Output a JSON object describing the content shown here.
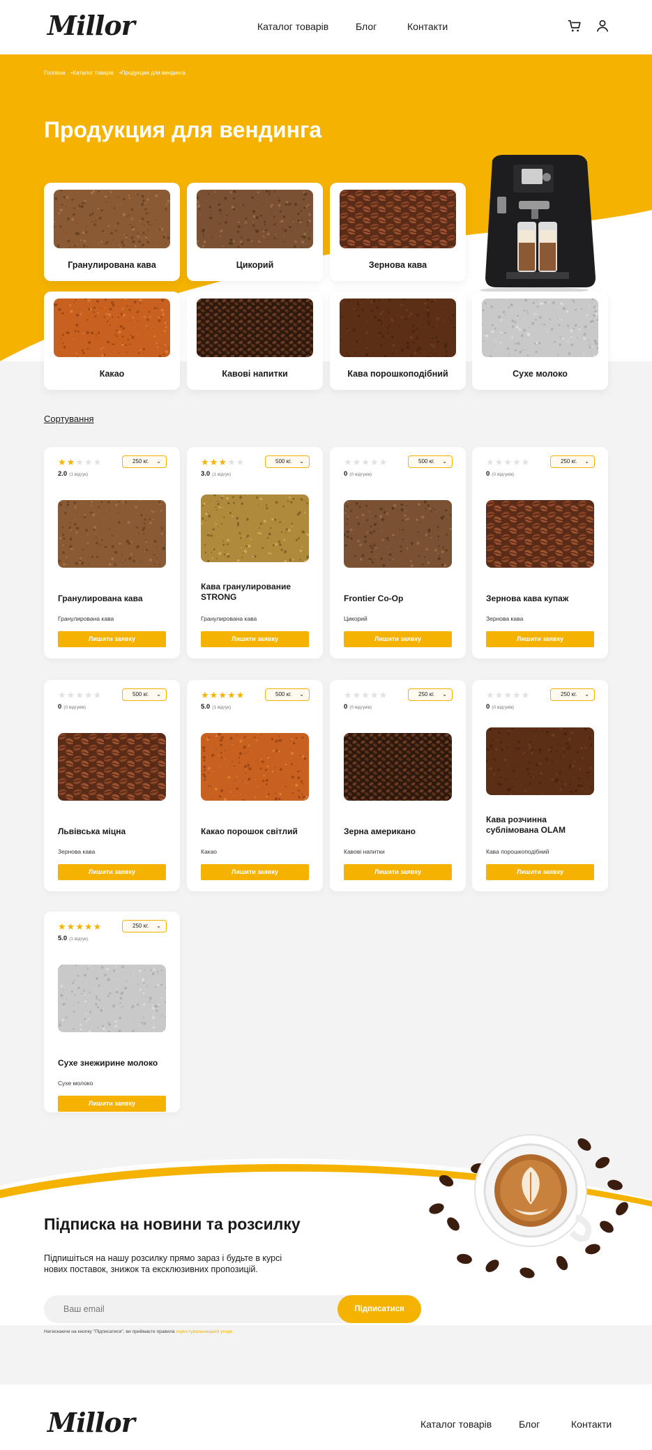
{
  "header": {
    "logo": "Millor",
    "nav": [
      "Каталог товарів",
      "Блог",
      "Контакти"
    ],
    "icons": [
      "cart-icon",
      "user-icon"
    ]
  },
  "hero": {
    "breadcrumbs": [
      "Головна",
      "•Каталог товарів",
      "•Продукция для вендинга"
    ],
    "title": "Продукция для вендинга"
  },
  "categories": [
    {
      "label": "Гранулирована кава",
      "image": "granulated"
    },
    {
      "label": "Цикорий",
      "image": "chicory"
    },
    {
      "label": "Зернова кава",
      "image": "beans"
    },
    {
      "label": "Какао",
      "image": "cocoa"
    },
    {
      "label": "Кавові напитки",
      "image": "darkbeans"
    },
    {
      "label": "Кава порошкоподібний",
      "image": "powder"
    },
    {
      "label": "Сухе молоко",
      "image": "milk"
    }
  ],
  "sort_label": "Сортування",
  "product_button": "Лишити заявку",
  "products": [
    {
      "name": "Гранулирована кава",
      "category": "Гранулирована кава",
      "stars": 2,
      "rating": "2.0",
      "reviews": "(1 відгук)",
      "weight": "250 кг.",
      "image": "granulated"
    },
    {
      "name": "Кава гранулирование STRONG",
      "category": "Гранулирована кава",
      "stars": 3,
      "rating": "3.0",
      "reviews": "(1 відгук)",
      "weight": "500 кг.",
      "image": "instantgold"
    },
    {
      "name": "Frontier Co-Op",
      "category": "Цикорий",
      "stars": 0,
      "rating": "0",
      "reviews": "(0 відгуків)",
      "weight": "500 кг.",
      "image": "chicory"
    },
    {
      "name": "Зернова кава купаж",
      "category": "Зернова кава",
      "stars": 0,
      "rating": "0",
      "reviews": "(0 відгуків)",
      "weight": "250 кг.",
      "image": "beans"
    },
    {
      "name": "Львівська міцна",
      "category": "Зернова кава",
      "stars": 0,
      "rating": "0",
      "reviews": "(0 відгуків)",
      "weight": "500 кг.",
      "image": "beans2"
    },
    {
      "name": "Какао порошок світлий",
      "category": "Какао",
      "stars": 5,
      "rating": "5.0",
      "reviews": "(1 відгук)",
      "weight": "500 кг.",
      "image": "cocoa"
    },
    {
      "name": "Зерна американо",
      "category": "Кавові напитки",
      "stars": 0,
      "rating": "0",
      "reviews": "(0 відгуків)",
      "weight": "250 кг.",
      "image": "darkbeans"
    },
    {
      "name": "Кава розчинна сублімована OLAM",
      "category": "Кава порошкоподібний",
      "stars": 0,
      "rating": "0",
      "reviews": "(0 відгуків)",
      "weight": "250 кг.",
      "image": "powder"
    },
    {
      "name": "Сухе знежирине молоко",
      "category": "Сухе молоко",
      "stars": 5,
      "rating": "5.0",
      "reviews": "(1 відгук)",
      "weight": "250 кг.",
      "image": "milk"
    }
  ],
  "subscribe": {
    "title": "Підписка на новини та розсилку",
    "text": "Підпишіться на нашу розсилку прямо зараз і будьте в курсі нових поставок, знижок та ексклюзивних пропозицій.",
    "placeholder": "Ваш email",
    "button": "Підписатися",
    "note": "Натискаючи на кнопку \"Підписатися\", ви приймаєте правила",
    "note_link": "користувальницької угоди"
  },
  "footer": {
    "logo": "Millor",
    "nav": [
      "Каталог товарів",
      "Блог",
      "Контакти"
    ]
  },
  "colors": {
    "accent": "#f5b200",
    "background": "#f3f3f3"
  }
}
